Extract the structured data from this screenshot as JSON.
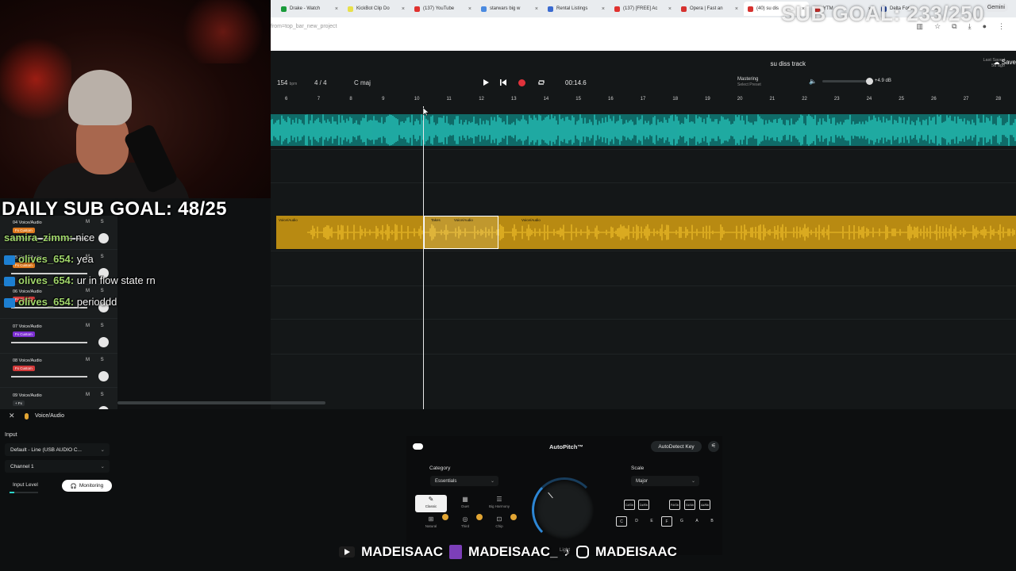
{
  "overlay": {
    "sub_goal_top": "SUB GOAL: 233/250",
    "daily_sub_goal": "DAILY SUB GOAL: 48/25",
    "chat": [
      {
        "user": "samira_zimm:",
        "msg": "nice"
      },
      {
        "user": "olives_654:",
        "msg": "yea"
      },
      {
        "user": "olives_654:",
        "msg": "ur in flow state rn"
      },
      {
        "user": "olives_654:",
        "msg": "perioddd"
      }
    ],
    "brand": [
      "MADEISAAC",
      "MADEISAAC_",
      "MADEISAAC"
    ]
  },
  "browser": {
    "tabs": [
      "Drake - Watch",
      "KickBot Clip Do",
      "(137) YouTube",
      "starwars big w",
      "Rental Listings",
      "(137) [FREE] Ac",
      "Opera | Fast an",
      "(40) su dis",
      "YTM",
      "Delta Fore"
    ],
    "gemini": "Gemini",
    "url": "from=top_bar_new_project"
  },
  "daw": {
    "project_title": "su diss track",
    "last_saved_label": "Last Saved",
    "last_saved_value": "5d ago",
    "save_label": "Save",
    "bpm": "154",
    "bpm_unit": "bpm",
    "time_signature": "4 / 4",
    "key": "C maj",
    "time": "00:14.6",
    "mastering_label": "Mastering",
    "mastering_preset": "Select Preset",
    "master_db": "+4.9 dB",
    "ruler": [
      "6",
      "7",
      "8",
      "9",
      "10",
      "11",
      "12",
      "13",
      "14",
      "15",
      "16",
      "17",
      "18",
      "19",
      "20",
      "21",
      "22",
      "23",
      "24",
      "25",
      "26",
      "27",
      "28"
    ],
    "clip_names": [
      "Voice/Audio",
      "Takes",
      "Voice/Audio",
      "Voice/Audio"
    ],
    "tracks": [
      {
        "name": "04 Voice/Audio",
        "badge": "Fx Custom",
        "badge_color": "#e07a1f"
      },
      {
        "name": "05 Voice/Audio",
        "badge": "Fx Custom",
        "badge_color": "#e07a1f"
      },
      {
        "name": "06 Voice/Audio",
        "badge": "Fx Custom",
        "badge_color": "#d23a3a"
      },
      {
        "name": "07 Voice/Audio",
        "badge": "Fx Custom",
        "badge_color": "#7b2ed1"
      },
      {
        "name": "08 Voice/Audio",
        "badge": "Fx Custom",
        "badge_color": "#d23a3a"
      },
      {
        "name": "09 Voice/Audio",
        "badge": "+ Fx",
        "badge_color": "#2a2e30"
      }
    ],
    "mute_solo": "M S"
  },
  "bottom": {
    "title": "Voice/Audio",
    "input_label": "Input",
    "input_device": "Default - Line (USB AUDIO C...",
    "channel": "Channel 1",
    "input_level_label": "Input Level",
    "monitoring_label": "Monitoring",
    "autopitch": {
      "title": "AutoPitch™",
      "autodetect": "AutoDetect Key",
      "category_label": "Category",
      "category_value": "Essentials",
      "modes": [
        "Classic",
        "Duet",
        "Big Harmony",
        "Natural",
        "Third",
        "Chip"
      ],
      "dial_label": "Light",
      "scale_label": "Scale",
      "scale_value": "Major",
      "sharps": [
        "C#/Db",
        "D#/Eb",
        "F#/Gb",
        "G#/Ab",
        "A#/Bb"
      ],
      "naturals": [
        "C",
        "D",
        "E",
        "F",
        "G",
        "A",
        "B"
      ]
    }
  },
  "colors": {
    "track_teal": "#0f6b68",
    "wave_teal": "#2ad3c8",
    "track_gold": "#b88a12",
    "wave_gold": "#f1c02a",
    "record_red": "#e0323b"
  }
}
